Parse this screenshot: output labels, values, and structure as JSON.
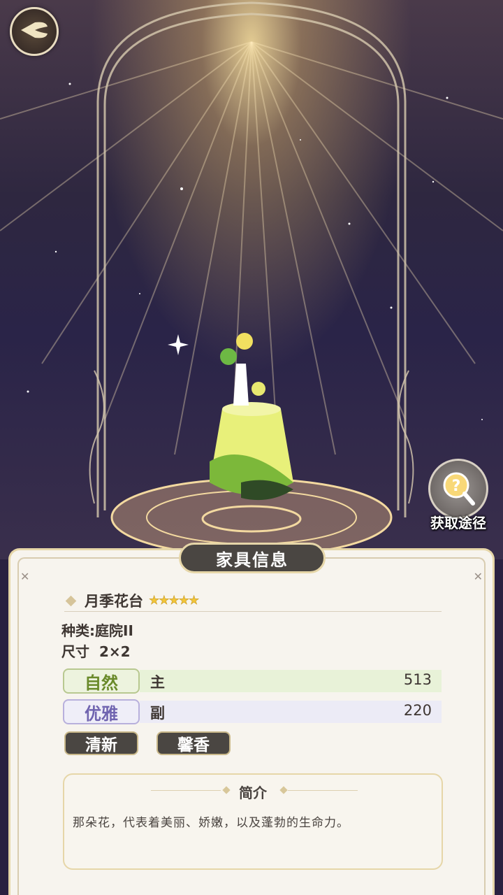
{
  "header": {
    "back_icon": "wing-back-icon"
  },
  "side_action": {
    "label": "获取途径",
    "icon": "magnifier-question-icon"
  },
  "panel": {
    "title": "家具信息",
    "item": {
      "name": "月季花台",
      "stars": "★★★★★",
      "star_count": 5,
      "category_label": "种类:",
      "category_value": "庭院II",
      "size_label": "尺寸",
      "size_value": "2×2"
    },
    "attributes": [
      {
        "tag": "自然",
        "type": "主",
        "value": "513",
        "color": "#e8f2d8",
        "tag_color": "#6a8a2a"
      },
      {
        "tag": "优雅",
        "type": "副",
        "value": "220",
        "color": "#ecebf6",
        "tag_color": "#7064b0"
      }
    ],
    "tags": [
      "清新",
      "馨香"
    ],
    "intro": {
      "title": "简介",
      "text": "那朵花，代表着美丽、娇嫩，以及蓬勃的生命力。"
    }
  },
  "colors": {
    "panel_bg": "#f7f4ee",
    "accent_gold": "#e6d6a8",
    "dark_tag": "#4a4642"
  }
}
